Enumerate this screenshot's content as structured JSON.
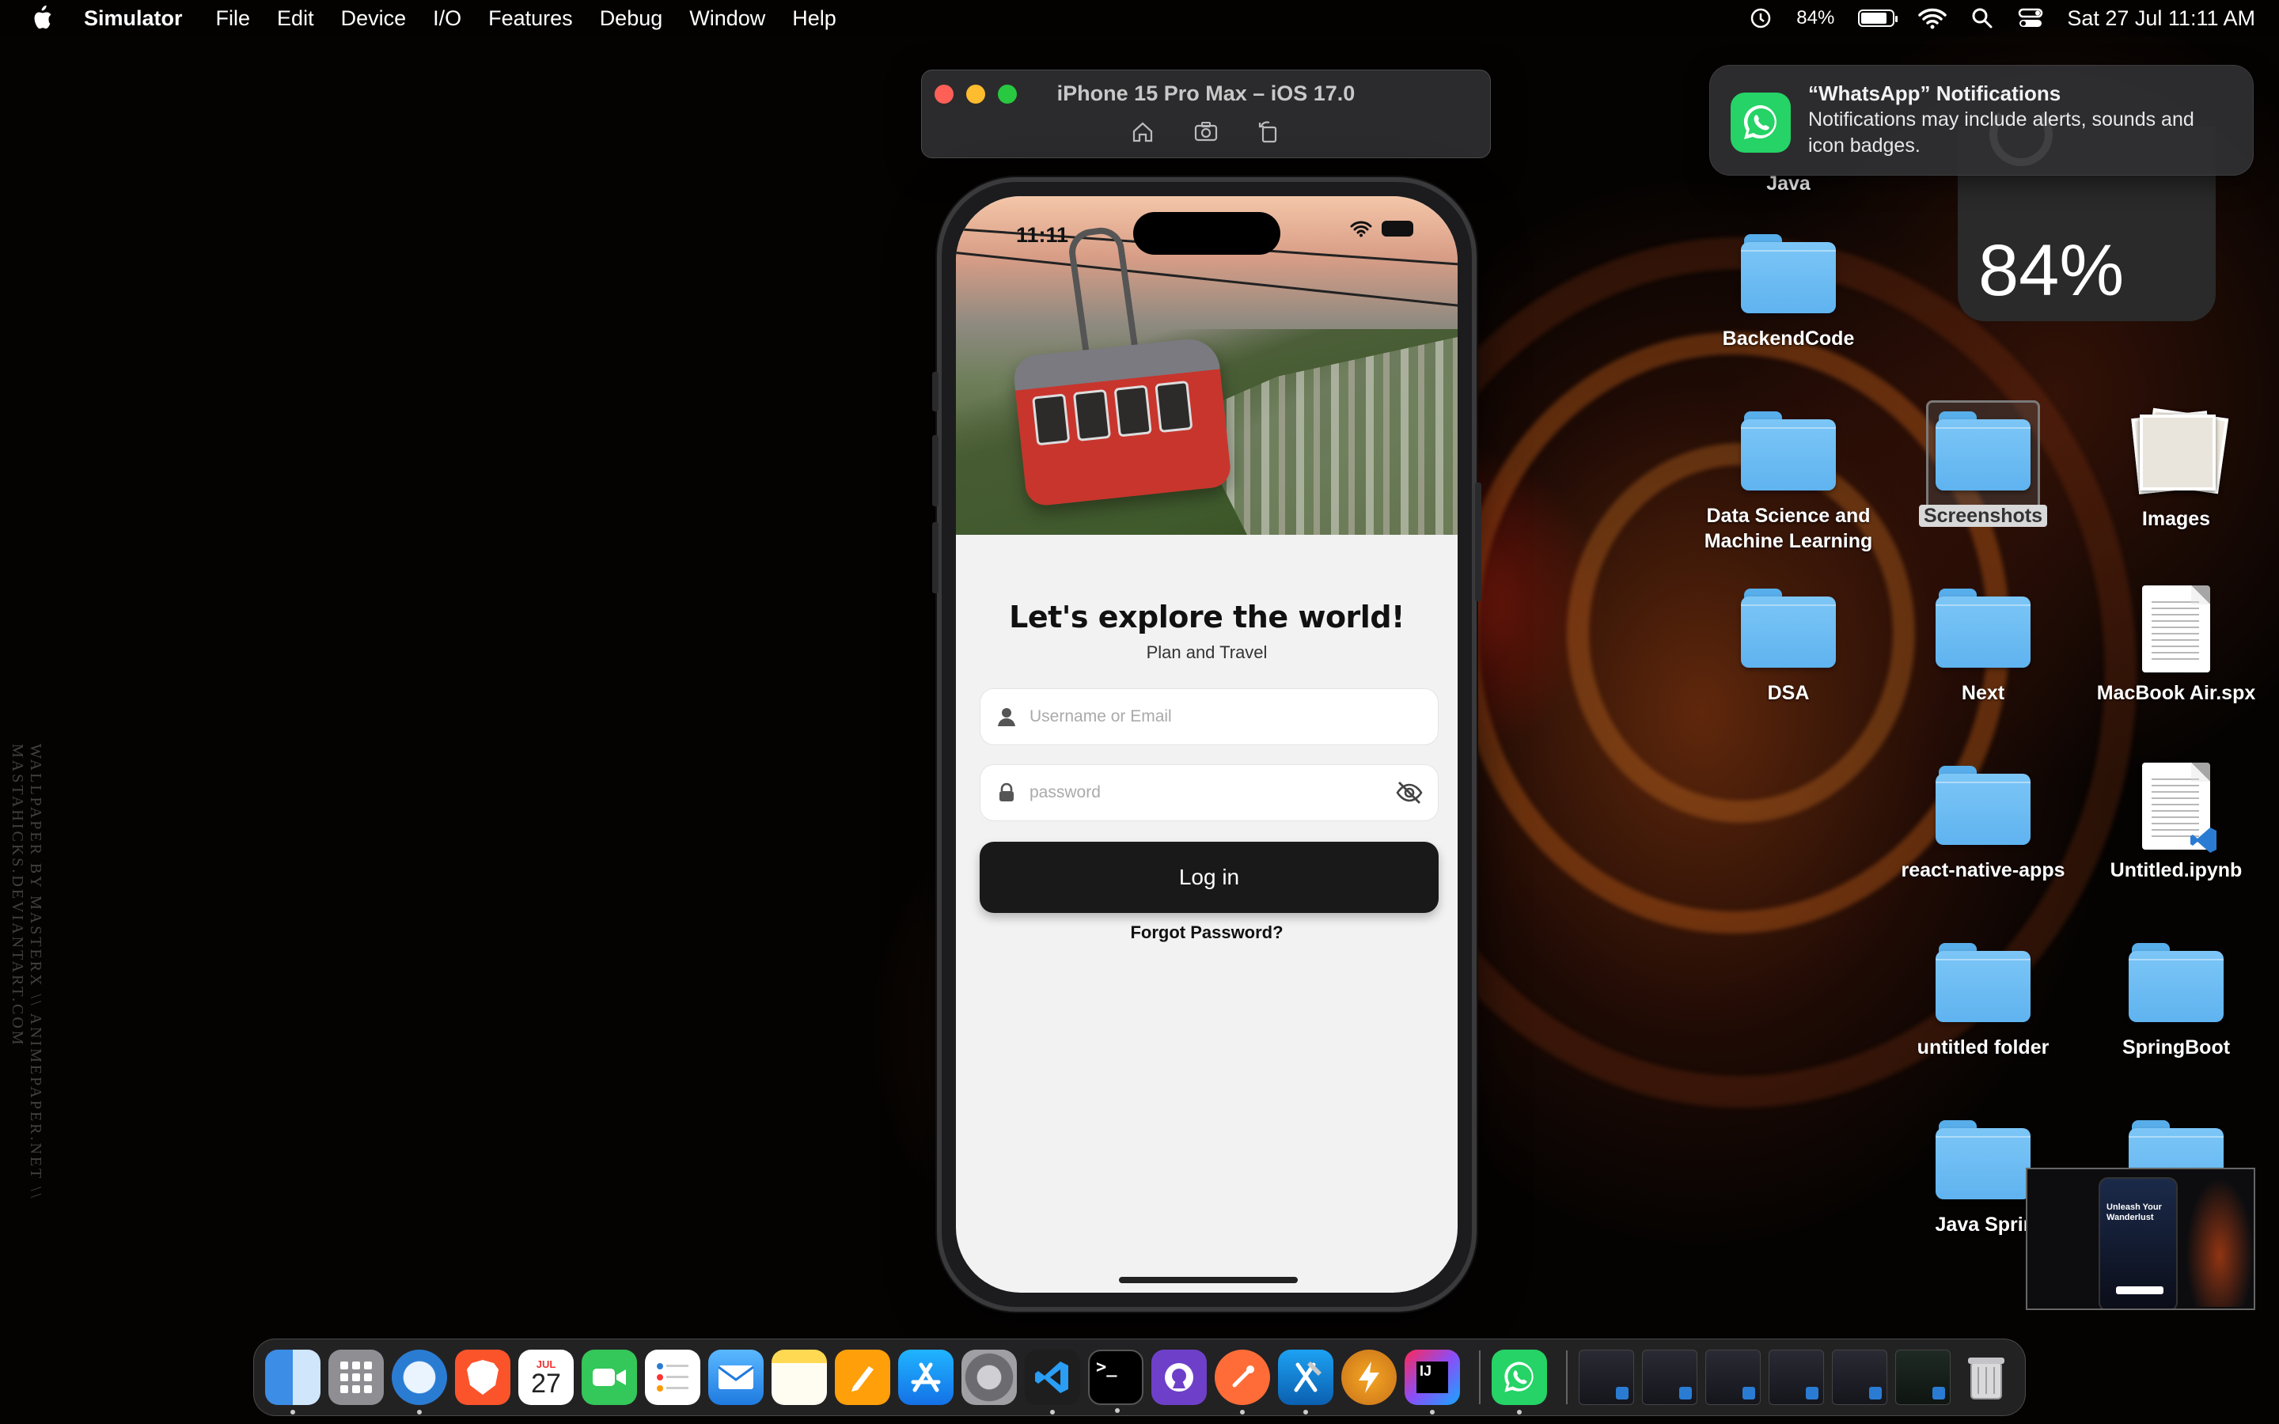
{
  "menubar": {
    "app_name": "Simulator",
    "menus": [
      "File",
      "Edit",
      "Device",
      "I/O",
      "Features",
      "Debug",
      "Window",
      "Help"
    ],
    "battery_percent": "84%",
    "battery_level": 0.84,
    "datetime": "Sat 27 Jul  11:11 AM"
  },
  "simulator": {
    "title": "iPhone 15 Pro Max – iOS 17.0",
    "toolbar": [
      "home-icon",
      "screenshot-icon",
      "rotate-icon"
    ]
  },
  "app": {
    "status_time": "11:11",
    "title": "Let's explore the world!",
    "subtitle": "Plan and Travel",
    "username_placeholder": "Username or Email",
    "password_placeholder": "password",
    "login_label": "Log in",
    "forgot_label": "Forgot Password?"
  },
  "notification": {
    "title": "“WhatsApp” Notifications",
    "body": "Notifications may include alerts, sounds and icon badges."
  },
  "widget": {
    "battery_percent": "84%"
  },
  "desktop": {
    "java_partial": "Java",
    "backend": "BackendCode",
    "data_science": "Data Science and Machine Learning",
    "screenshots": "Screenshots",
    "images": "Images",
    "dsa": "DSA",
    "next": "Next",
    "macbook_spx": "MacBook Air.spx",
    "react_native": "react-native-apps",
    "ipynb": "Untitled.ipynb",
    "untitled_folder": "untitled folder",
    "springboot": "SpringBoot",
    "java_spring": "Java Sprir"
  },
  "thumbnail": {
    "text": "Unleash Your Wanderlust"
  },
  "wallpaper_credit": "WALLPAPER BY MASTERX \\\\ ANIMEPAPER.NET \\\\ MASTAHICKS.DEVIANTART.COM",
  "dock": {
    "calendar_month": "JUL",
    "calendar_day": "27",
    "apps": [
      "finder-icon",
      "launchpad-icon",
      "safari-icon",
      "brave-icon",
      "calendar-icon",
      "facetime-icon",
      "reminders-icon",
      "mail-icon",
      "notes-icon",
      "pages-icon",
      "app-store-icon",
      "system-settings-icon",
      "vscode-icon",
      "terminal-icon",
      "github-desktop-icon",
      "postman-icon",
      "xcode-icon",
      "reeder-icon",
      "intellij-icon",
      "whatsapp-icon",
      "trash-icon"
    ],
    "colors": {
      "accent": "#2a7cd3",
      "whatsapp": "#25d366"
    }
  }
}
